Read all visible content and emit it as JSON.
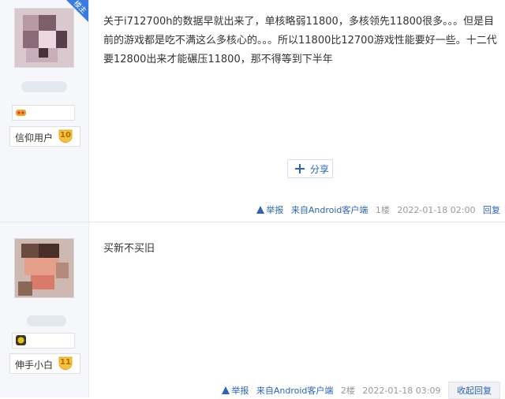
{
  "posts": [
    {
      "badge": "楼主",
      "rank_label": "信仰用户",
      "rank_level": "10",
      "content": "关于i712700h的数据早就出来了，单核略弱11800，多核领先11800很多。。。但是目前的游戏都是吃不满这么多核心的。。。所以11800比12700游戏性能要好一些。十二代要12800出来才能碾压11800，那不得等到下半年",
      "share_label": "分享",
      "report_label": "举报",
      "client_label": "来自Android客户端",
      "floor": "1楼",
      "time": "2022-01-18 02:00",
      "reply_label": "回复",
      "medal_color": "#f0a030"
    },
    {
      "rank_label": "伸手小白",
      "rank_level": "11",
      "content": "买新不买旧",
      "report_label": "举报",
      "client_label": "来自Android客户端",
      "floor": "2楼",
      "time": "2022-01-18 03:09",
      "reply_label": "收起回复",
      "medal_color": "#4a9a3a"
    }
  ],
  "colors": {
    "accent": "#2d64b3",
    "badge": "#3b7be0",
    "level": "#f5c242"
  },
  "icons": {
    "share": "plus-share-icon",
    "report": "warning-icon",
    "level": "heart-shield-icon"
  }
}
